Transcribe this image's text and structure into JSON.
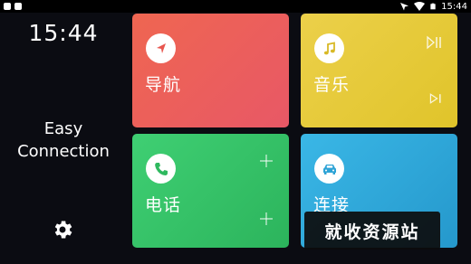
{
  "status_bar": {
    "time": "15:44",
    "icons": [
      "notification-square-icon",
      "notification-square-icon",
      "location-icon",
      "wifi-icon",
      "battery-icon"
    ]
  },
  "sidebar": {
    "clock": "15:44",
    "brand_line1": "Easy",
    "brand_line2": "Connection",
    "settings_icon": "gear-icon"
  },
  "tiles": {
    "navigation": {
      "label": "导航",
      "icon": "navigation-arrow-icon",
      "color": "#ec5f5b"
    },
    "music": {
      "label": "音乐",
      "icon": "music-note-icon",
      "color": "#e8ca3c",
      "controls": [
        "play-pause-icon",
        "skip-next-icon"
      ]
    },
    "phone": {
      "label": "电话",
      "icon": "phone-icon",
      "color": "#36c167",
      "controls": [
        "add-icon",
        "add-icon"
      ]
    },
    "connect": {
      "label": "连接",
      "icon": "car-icon",
      "color": "#30a8dc"
    }
  },
  "watermark": {
    "text": "就收资源站"
  }
}
